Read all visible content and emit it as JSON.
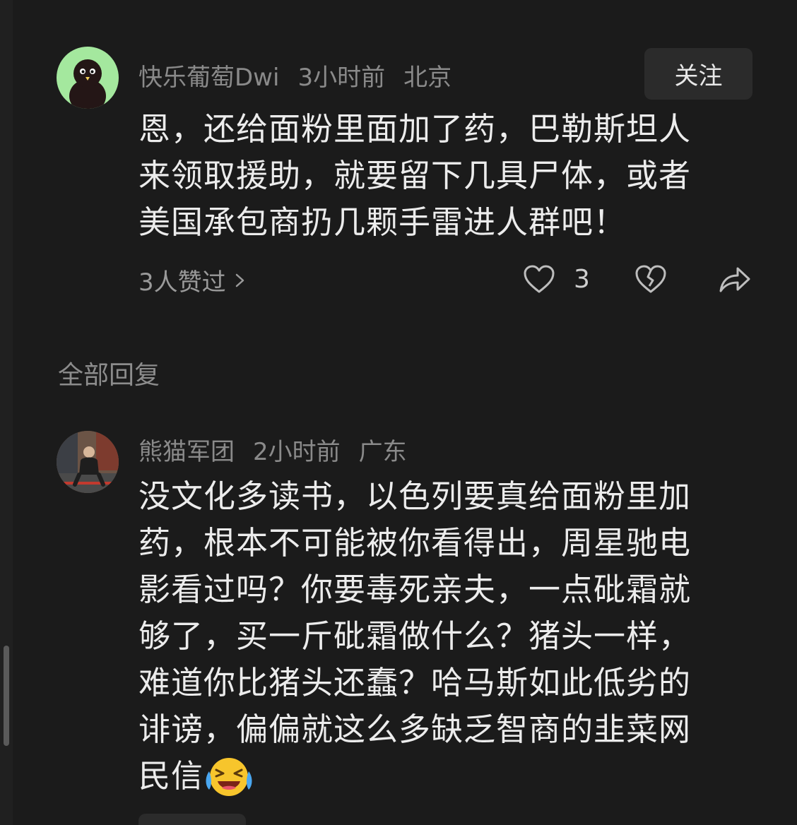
{
  "comments": [
    {
      "username": "快乐葡萄Dwi",
      "time": "3小时前",
      "location": "北京",
      "follow_label": "关注",
      "text_lines": [
        "恩，还给面粉里面加了药，巴勒斯坦人",
        "来领取援助，就要留下几具尸体，或者",
        "美国承包商扔几颗手雷进人群吧！"
      ],
      "likes_label": "3人赞过",
      "like_count": "3",
      "avatar_colors": {
        "bg": "#a4e89e",
        "bird": "#241616"
      }
    },
    {
      "username": "熊猫军团",
      "time": "2小时前",
      "location": "广东",
      "text_lines": [
        "没文化多读书，以色列要真给面粉里加",
        "药，根本不可能被你看得出，周星驰电",
        "影看过吗？你要毒死亲夫，一点砒霜就",
        "够了，买一斤砒霜做什么？猪头一样，",
        "难道你比猪头还蠢？哈马斯如此低劣的",
        "诽谤，偏偏就这么多缺乏智商的韭菜网",
        "民信"
      ],
      "emoji": "laughing-crying-emoji"
    }
  ],
  "replies_section": {
    "title": "全部回复"
  },
  "colors": {
    "background": "#1b1b1b",
    "meta_text": "#8a8a8a",
    "body_text": "#ececec",
    "button_bg": "#2b2b2b"
  }
}
